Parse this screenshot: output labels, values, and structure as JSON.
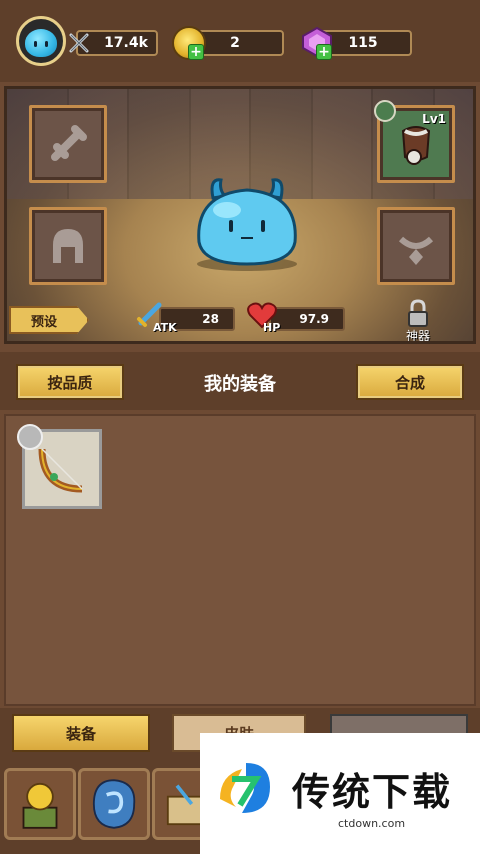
{
  "top_bar": {
    "power_value": "17.4k",
    "coins_value": "2",
    "gems_value": "115"
  },
  "arena": {
    "right_top_slot_level": "Lv1",
    "preset_label": "预设",
    "atk_label": "ATK",
    "atk_value": "28",
    "hp_label": "HP",
    "hp_value": "97.9",
    "artifact_label": "神器"
  },
  "equipment_header": {
    "sort_button": "按品质",
    "title": "我的装备",
    "craft_button": "合成"
  },
  "bottom_tabs": {
    "equip_tab": "装备",
    "skin_tab": "皮肤",
    "third_tab": ""
  },
  "watermark": {
    "brand": "传统下载",
    "url": "ctdown.com"
  },
  "colors": {
    "gold": "#e8c15a",
    "wood": "#6d4a33",
    "slime": "#35b7e6"
  }
}
